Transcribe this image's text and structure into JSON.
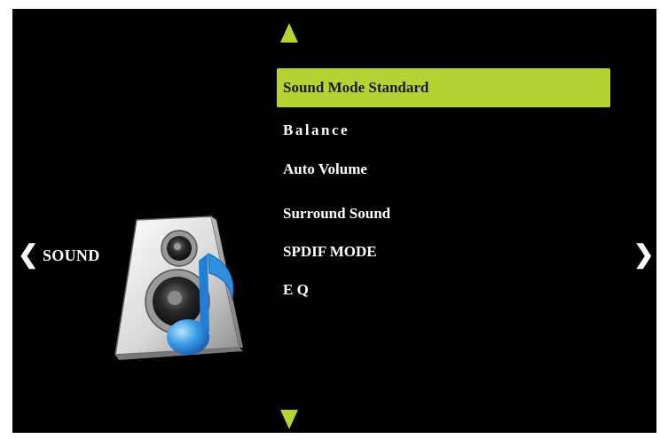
{
  "colors": {
    "accent": "#b5d334",
    "background": "#000000",
    "text": "#ffffff"
  },
  "category": {
    "label": "SOUND",
    "icon": "speaker-music-note-icon"
  },
  "nav": {
    "left_glyph": "❮",
    "right_glyph": "❯"
  },
  "menu": {
    "selected_index": 0,
    "items": [
      {
        "label": "Sound Mode Standard"
      },
      {
        "label": "Balance"
      },
      {
        "label": "Auto Volume"
      },
      {
        "label": "Surround Sound"
      },
      {
        "label": "SPDIF MODE"
      },
      {
        "label": "E Q"
      }
    ]
  }
}
